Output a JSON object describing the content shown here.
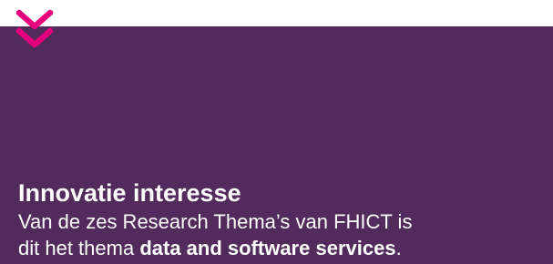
{
  "colors": {
    "panel_background": "#522a5b",
    "accent": "#e6007e",
    "text": "#ffffff",
    "top_background": "#ffffff"
  },
  "icon": {
    "name": "double-chevron-down-icon"
  },
  "card": {
    "title": "Innovatie interesse",
    "description_line1": "Van de zes Research Thema’s van FHICT is",
    "description_line2_prefix": "dit het thema ",
    "description_line2_bold": "data and software services",
    "description_line2_suffix": "."
  }
}
